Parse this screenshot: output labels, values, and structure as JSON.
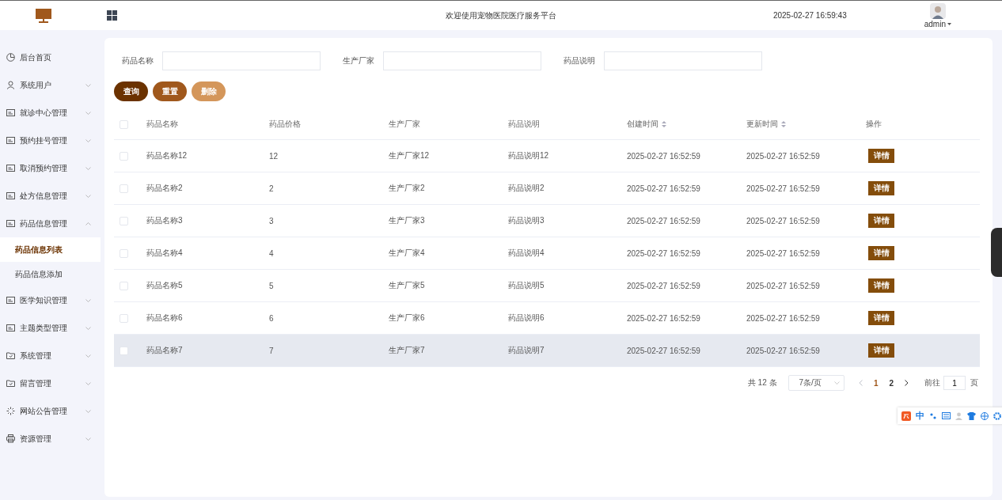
{
  "header": {
    "title": "欢迎使用宠物医院医疗服务平台",
    "datetime": "2025-02-27 16:59:43",
    "user": "admin"
  },
  "sidebar": {
    "items": [
      {
        "label": "后台首页",
        "kind": "clock"
      },
      {
        "label": "系统用户",
        "kind": "user",
        "expanded": false
      },
      {
        "label": "就诊中心管理",
        "kind": "card",
        "expanded": false
      },
      {
        "label": "预约挂号管理",
        "kind": "card",
        "expanded": false
      },
      {
        "label": "取消预约管理",
        "kind": "card",
        "expanded": false
      },
      {
        "label": "处方信息管理",
        "kind": "card",
        "expanded": false
      },
      {
        "label": "药品信息管理",
        "kind": "card",
        "expanded": true,
        "children": [
          {
            "label": "药品信息列表",
            "selected": true
          },
          {
            "label": "药品信息添加",
            "selected": false
          }
        ]
      },
      {
        "label": "医学知识管理",
        "kind": "card",
        "expanded": false
      },
      {
        "label": "主题类型管理",
        "kind": "card",
        "expanded": false
      },
      {
        "label": "系统管理",
        "kind": "folder",
        "expanded": false
      },
      {
        "label": "留言管理",
        "kind": "folder",
        "expanded": false
      },
      {
        "label": "网站公告管理",
        "kind": "sparkle",
        "expanded": false
      },
      {
        "label": "资源管理",
        "kind": "printer",
        "expanded": false
      }
    ]
  },
  "search": {
    "fields": [
      {
        "label": "药品名称"
      },
      {
        "label": "生产厂家"
      },
      {
        "label": "药品说明"
      }
    ],
    "buttons": [
      {
        "label": "查询",
        "kind": "primary"
      },
      {
        "label": "重置",
        "kind": "secondary"
      },
      {
        "label": "删除",
        "kind": "danger"
      }
    ]
  },
  "table": {
    "select_all_checked": false,
    "columns": [
      {
        "label": "药品名称",
        "sortable": false
      },
      {
        "label": "药品价格",
        "sortable": false
      },
      {
        "label": "生产厂家",
        "sortable": false
      },
      {
        "label": "药品说明",
        "sortable": false
      },
      {
        "label": "创建时间",
        "sortable": true
      },
      {
        "label": "更新时间",
        "sortable": true
      },
      {
        "label": "操作",
        "sortable": false
      }
    ],
    "rows": [
      {
        "checked": false,
        "highlighted": false,
        "cells": [
          "药品名称12",
          "12",
          "生产厂家12",
          "药品说明12",
          "2025-02-27 16:52:59",
          "2025-02-27 16:52:59"
        ],
        "action": "详情"
      },
      {
        "checked": false,
        "highlighted": false,
        "cells": [
          "药品名称2",
          "2",
          "生产厂家2",
          "药品说明2",
          "2025-02-27 16:52:59",
          "2025-02-27 16:52:59"
        ],
        "action": "详情"
      },
      {
        "checked": false,
        "highlighted": false,
        "cells": [
          "药品名称3",
          "3",
          "生产厂家3",
          "药品说明3",
          "2025-02-27 16:52:59",
          "2025-02-27 16:52:59"
        ],
        "action": "详情"
      },
      {
        "checked": false,
        "highlighted": false,
        "cells": [
          "药品名称4",
          "4",
          "生产厂家4",
          "药品说明4",
          "2025-02-27 16:52:59",
          "2025-02-27 16:52:59"
        ],
        "action": "详情"
      },
      {
        "checked": false,
        "highlighted": false,
        "cells": [
          "药品名称5",
          "5",
          "生产厂家5",
          "药品说明5",
          "2025-02-27 16:52:59",
          "2025-02-27 16:52:59"
        ],
        "action": "详情"
      },
      {
        "checked": false,
        "highlighted": false,
        "cells": [
          "药品名称6",
          "6",
          "生产厂家6",
          "药品说明6",
          "2025-02-27 16:52:59",
          "2025-02-27 16:52:59"
        ],
        "action": "详情"
      },
      {
        "checked": false,
        "highlighted": true,
        "cells": [
          "药品名称7",
          "7",
          "生产厂家7",
          "药品说明7",
          "2025-02-27 16:52:59",
          "2025-02-27 16:52:59"
        ],
        "action": "详情"
      }
    ]
  },
  "pagination": {
    "total": "共 12 条",
    "page_size": "7条/页",
    "pages": [
      {
        "label": "1",
        "selected": true
      },
      {
        "label": "2",
        "selected": false
      }
    ],
    "goto_label": "前往",
    "goto_value": "1",
    "goto_suffix": "页"
  },
  "ime_toolbar": {
    "mode": "中"
  }
}
